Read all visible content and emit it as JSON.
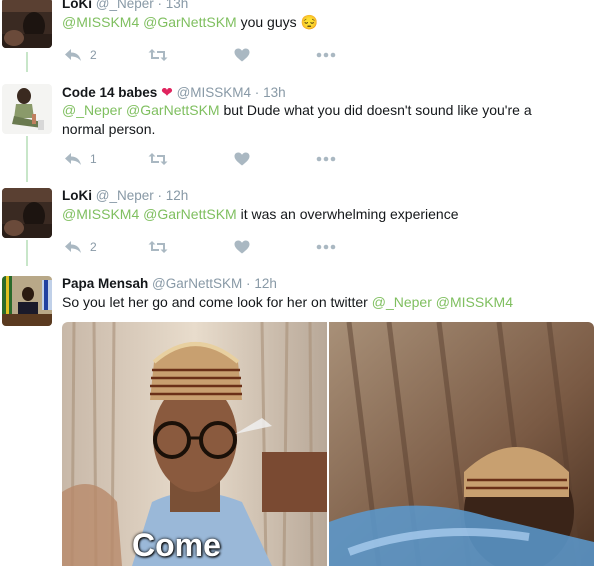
{
  "tweets": [
    {
      "name": "LoKi",
      "handle": "@_Neper",
      "dot": "·",
      "time": "13h",
      "text_parts": [
        {
          "t": "@MISSKM4",
          "mention": true
        },
        {
          "t": " ",
          "mention": false
        },
        {
          "t": "@GarNettSKM",
          "mention": true
        },
        {
          "t": " you guys ",
          "mention": false
        },
        {
          "t": "😔",
          "mention": false
        }
      ],
      "reply_count": "2",
      "avatar_icon": "avatar-dark-photo"
    },
    {
      "name": "Code 14 babes",
      "heart": "❤",
      "handle": "@MISSKM4",
      "dot": "·",
      "time": "13h",
      "text_parts": [
        {
          "t": "@_Neper",
          "mention": true
        },
        {
          "t": " ",
          "mention": false
        },
        {
          "t": "@GarNettSKM",
          "mention": true
        },
        {
          "t": " but Dude what you did doesn't sound like you're a normal person.",
          "mention": false
        }
      ],
      "reply_count": "1",
      "avatar_icon": "avatar-person-sitting"
    },
    {
      "name": "LoKi",
      "handle": "@_Neper",
      "dot": "·",
      "time": "12h",
      "text_parts": [
        {
          "t": "@MISSKM4",
          "mention": true
        },
        {
          "t": " ",
          "mention": false
        },
        {
          "t": "@GarNettSKM",
          "mention": true
        },
        {
          "t": " it was an overwhelming experience",
          "mention": false
        }
      ],
      "reply_count": "2",
      "avatar_icon": "avatar-dark-photo"
    },
    {
      "name": "Papa Mensah",
      "handle": "@GarNettSKM",
      "dot": "·",
      "time": "12h",
      "text_parts": [
        {
          "t": "So you let her go and come look for her on twitter ",
          "mention": false
        },
        {
          "t": "@_Neper",
          "mention": true
        },
        {
          "t": " ",
          "mention": false
        },
        {
          "t": "@MISSKM4",
          "mention": true
        }
      ],
      "avatar_icon": "avatar-office-photo"
    }
  ],
  "media": {
    "caption": "Come"
  },
  "colors": {
    "mention": "#7fbf5f",
    "thread_line": "#c8e6c9",
    "muted": "#8899a6",
    "heart": "#e0245e"
  }
}
